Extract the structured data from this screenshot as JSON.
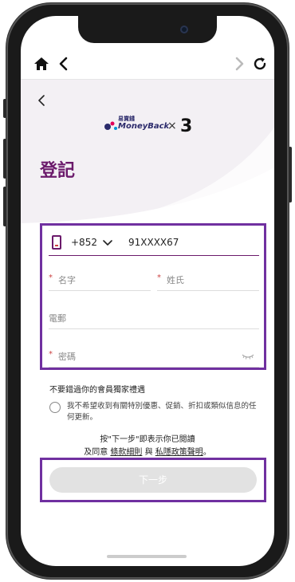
{
  "browser": {
    "home_icon": "home-icon",
    "back_icon": "chevron-left-icon",
    "forward_icon": "chevron-right-icon",
    "refresh_icon": "refresh-icon"
  },
  "header": {
    "back_icon": "chevron-left-icon",
    "logo_small": "易賞錢",
    "logo_word": "MoneyBack",
    "times": "×",
    "partner": "3"
  },
  "page_title": "登記",
  "form": {
    "country_code": "+852",
    "phone_value": "91XXXX67",
    "first_name_placeholder": "名字",
    "last_name_placeholder": "姓氏",
    "email_placeholder": "電郵",
    "password_placeholder": "密碼",
    "required_mark": "*"
  },
  "promo": {
    "title": "不要錯過你的會員獨家禮遇",
    "opt_out_text": "我不希望收到有關特別優惠、促銷、折扣或類似信息的任何更新。"
  },
  "consent": {
    "line1": "按\"下一步\"即表示你已閱讀",
    "prefix": "及同意",
    "terms_link": "條款細則",
    "and": "與",
    "privacy_link": "私隱政策聲明",
    "suffix": "。"
  },
  "next_button_label": "下一步",
  "colors": {
    "brand_purple": "#6b1a6b",
    "highlight_border": "#7030a0",
    "required_red": "#c44444"
  }
}
